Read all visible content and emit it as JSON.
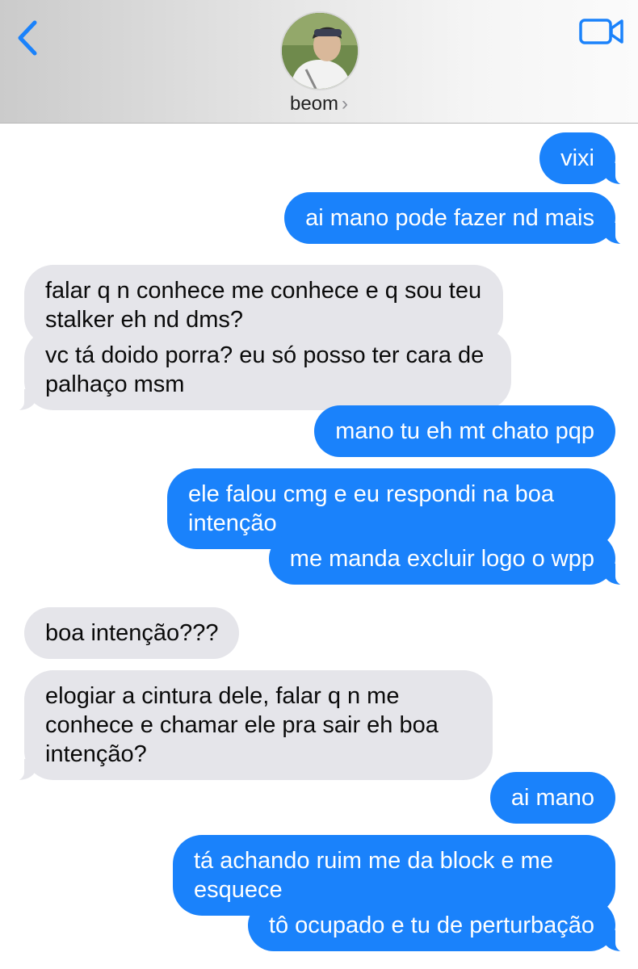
{
  "header": {
    "contact_name": "beom",
    "contact_chevron": "›",
    "back_icon": "chevron-left-icon",
    "video_icon": "video-camera-icon",
    "accent_color": "#1a82fb"
  },
  "messages": [
    {
      "from": "me",
      "text": "vixi"
    },
    {
      "from": "me",
      "text": "ai mano pode fazer nd mais"
    },
    {
      "from": "them",
      "text": "falar q n conhece me conhece e q sou teu stalker eh nd dms?"
    },
    {
      "from": "them",
      "text": "vc tá doido porra? eu só posso ter cara de palhaço msm"
    },
    {
      "from": "me",
      "text": "mano tu eh mt chato pqp"
    },
    {
      "from": "me",
      "text": "ele falou cmg e eu respondi na boa intenção"
    },
    {
      "from": "me",
      "text": "me manda excluir logo o wpp"
    },
    {
      "from": "them",
      "text": "boa intenção???"
    },
    {
      "from": "them",
      "text": "elogiar a cintura dele, falar q n me conhece e chamar ele pra sair eh boa intenção?"
    },
    {
      "from": "me",
      "text": "ai mano"
    },
    {
      "from": "me",
      "text": "tá achando ruim me da block e me esquece"
    },
    {
      "from": "me",
      "text": "tô ocupado e tu de perturbação"
    }
  ]
}
